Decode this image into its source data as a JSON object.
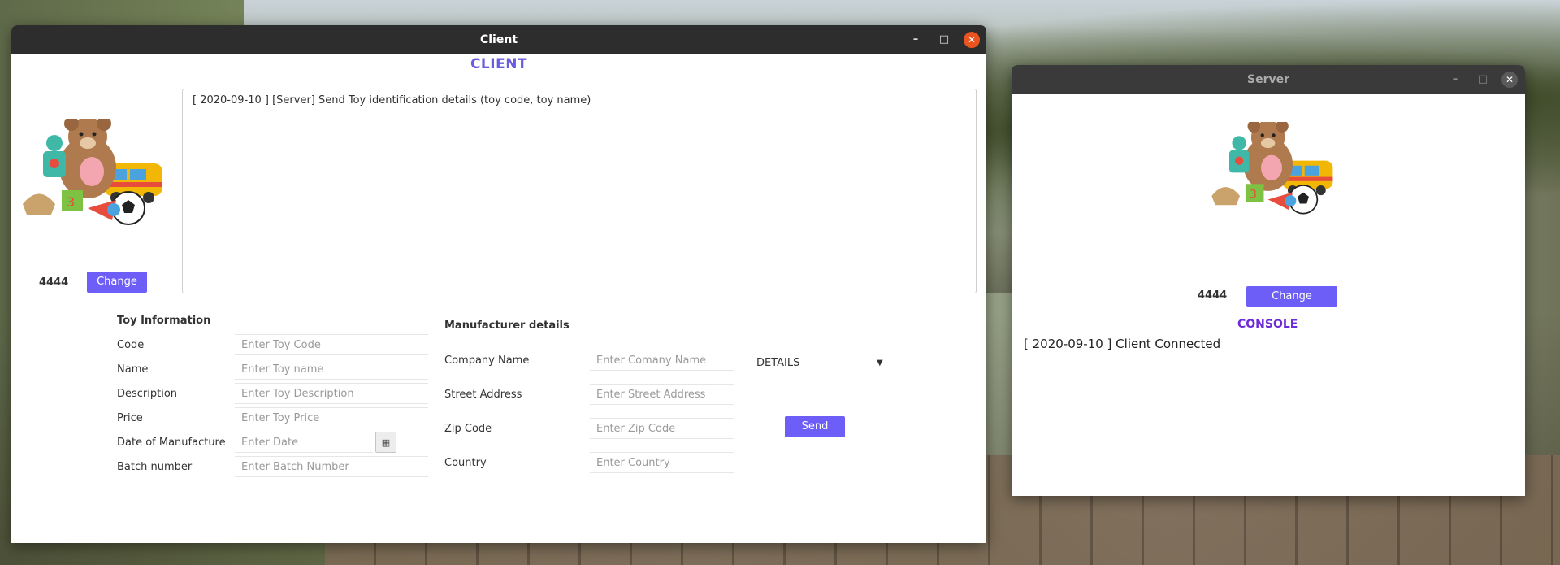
{
  "client": {
    "window_title": "Client",
    "heading": "CLIENT",
    "log": "[ 2020-09-10 ] [Server]  Send Toy identification details (toy code, toy name)",
    "port": "4444",
    "change_label": "Change",
    "toy_info": {
      "title": "Toy Information",
      "fields": [
        {
          "label": "Code",
          "placeholder": "Enter Toy Code"
        },
        {
          "label": "Name",
          "placeholder": "Enter Toy name"
        },
        {
          "label": "Description",
          "placeholder": "Enter Toy Description"
        },
        {
          "label": "Price",
          "placeholder": "Enter Toy Price"
        },
        {
          "label": "Date of Manufacture",
          "placeholder": "Enter Date"
        },
        {
          "label": "Batch number",
          "placeholder": "Enter Batch Number"
        }
      ]
    },
    "manufacturer": {
      "title": "Manufacturer details",
      "fields": [
        {
          "label": "Company Name",
          "placeholder": "Enter Comany Name"
        },
        {
          "label": "Street Address",
          "placeholder": "Enter Street Address"
        },
        {
          "label": "Zip Code",
          "placeholder": "Enter Zip Code"
        },
        {
          "label": "Country",
          "placeholder": "Enter Country"
        }
      ]
    },
    "details_dropdown": "DETAILS",
    "send_label": "Send"
  },
  "server": {
    "window_title": "Server",
    "port": "4444",
    "change_label": "Change",
    "console_heading": "CONSOLE",
    "console_line": "[ 2020-09-10 ] Client Connected"
  },
  "window_controls": {
    "minimize": "–",
    "maximize": "□",
    "close": "✕"
  },
  "colors": {
    "accent": "#6c5ef6",
    "heading_client": "#6a5be0",
    "heading_console": "#6c2bd9",
    "close_btn": "#e95420"
  }
}
